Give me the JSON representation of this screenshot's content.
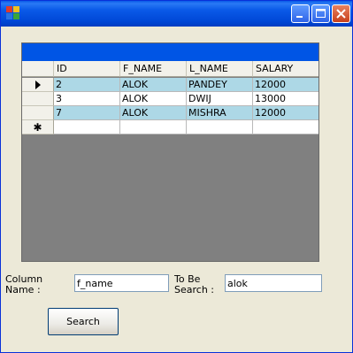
{
  "window": {
    "title": ""
  },
  "grid": {
    "columns": [
      "ID",
      "F_NAME",
      "L_NAME",
      "SALARY"
    ],
    "rows": [
      {
        "selected": true,
        "cells": [
          "2",
          "ALOK",
          "PANDEY",
          "12000"
        ]
      },
      {
        "selected": false,
        "cells": [
          "3",
          "ALOK",
          "DWIJ",
          "13000"
        ]
      },
      {
        "selected": true,
        "cells": [
          "7",
          "ALOK",
          "MISHRA",
          "12000"
        ]
      }
    ],
    "current_row_glyph": "▶",
    "new_row_glyph": "✱"
  },
  "form": {
    "column_label": "Column\nName :",
    "column_value": "f_name",
    "search_label": "To Be\nSearch :",
    "search_value": "alok",
    "search_button": "Search"
  },
  "colors": {
    "selection": "#add8e6",
    "caption": "#0055e5",
    "grid_background": "#808080"
  }
}
